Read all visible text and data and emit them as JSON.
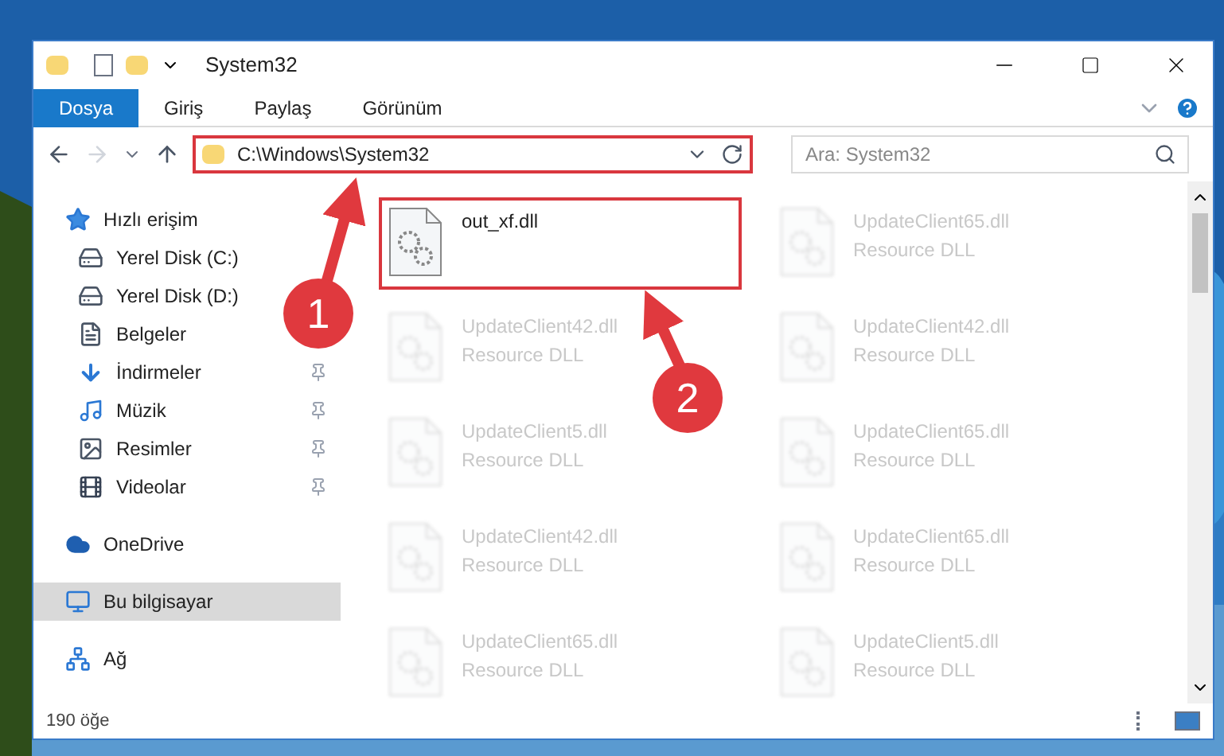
{
  "window": {
    "title": "System32"
  },
  "ribbon_tabs": [
    {
      "label": "Dosya",
      "kind": "file"
    },
    {
      "label": "Giriş",
      "kind": "tab"
    },
    {
      "label": "Paylaş",
      "kind": "tab"
    },
    {
      "label": "Görünüm",
      "kind": "tab"
    }
  ],
  "address_bar": {
    "path": "C:\\Windows\\System32",
    "highlighted": true
  },
  "search": {
    "placeholder": "Ara: System32"
  },
  "sidebar": {
    "items": [
      {
        "label": "Hızlı erişim",
        "kind": "star",
        "selected": false,
        "children": [
          {
            "label": "Yerel Disk (C:)",
            "kind": "drive-c",
            "pinned": false
          },
          {
            "label": "Yerel Disk (D:)",
            "kind": "drive",
            "pinned": false
          },
          {
            "label": "Belgeler",
            "kind": "docs",
            "pinned": false
          },
          {
            "label": "İndirmeler",
            "kind": "download",
            "pinned": true
          },
          {
            "label": "Müzik",
            "kind": "music",
            "pinned": true
          },
          {
            "label": "Resimler",
            "kind": "pictures",
            "pinned": true
          },
          {
            "label": "Videolar",
            "kind": "videos",
            "pinned": true
          }
        ]
      },
      {
        "label": "OneDrive",
        "kind": "cloud",
        "selected": false
      },
      {
        "label": "Bu bilgisayar",
        "kind": "pc",
        "selected": true
      },
      {
        "label": "Ağ",
        "kind": "network",
        "selected": false
      }
    ]
  },
  "files": [
    {
      "name": "out_xf.dll",
      "highlighted": true
    },
    {
      "name": "UpdateClient65.dll",
      "type": "Resource DLL",
      "highlighted": false
    },
    {
      "name": "UpdateClient42.dll",
      "type": "Resource DLL",
      "highlighted": false
    },
    {
      "name": "UpdateClient42.dll",
      "type": "Resource DLL",
      "highlighted": false
    },
    {
      "name": "UpdateClient5.dll",
      "type": "Resource DLL",
      "highlighted": false
    },
    {
      "name": "UpdateClient65.dll",
      "type": "Resource DLL",
      "highlighted": false
    },
    {
      "name": "UpdateClient42.dll",
      "type": "Resource DLL",
      "highlighted": false
    },
    {
      "name": "UpdateClient65.dll",
      "type": "Resource DLL",
      "highlighted": false
    },
    {
      "name": "UpdateClient65.dll",
      "type": "Resource DLL",
      "highlighted": false
    },
    {
      "name": "UpdateClient5.dll",
      "type": "Resource DLL",
      "highlighted": false
    }
  ],
  "status_bar": {
    "count": "190 öğe"
  },
  "annotations": [
    {
      "label": "1"
    },
    {
      "label": "2"
    }
  ]
}
